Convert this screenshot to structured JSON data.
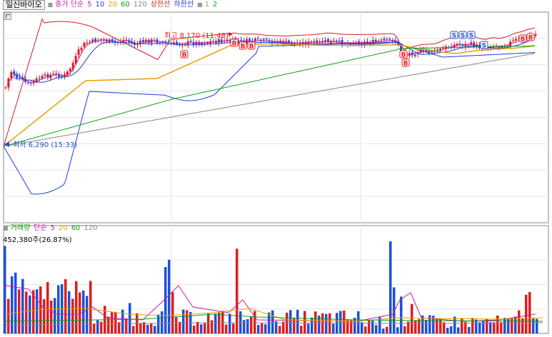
{
  "price_legend": {
    "stock_name": "일신바이오",
    "close_label": "종가 단순",
    "ma_periods": [
      "5",
      "10",
      "20",
      "60",
      "120"
    ],
    "ma_colors": [
      "#c81eaa",
      "#1e3cd2",
      "#e6a000",
      "#12a012",
      "#888888"
    ],
    "upper_limit_label": "상한선",
    "lower_limit_label": "하한선",
    "extra_values": [
      "1",
      "2"
    ],
    "colors": {
      "close": "#c81eaa",
      "upper": "#d21e1e",
      "lower": "#1e3cd2",
      "extra1": "#999999",
      "extra2": "#12a012"
    }
  },
  "volume_legend": {
    "title": "거래량",
    "ma_label": "단순",
    "ma_periods": [
      "5",
      "20",
      "60",
      "120"
    ],
    "ma_colors": [
      "#c81eaa",
      "#e6a000",
      "#12a012",
      "#888888"
    ],
    "title_color": "#12a012",
    "readout": "452,380주(26.87%)"
  },
  "annotations": {
    "high": "최고 8,170 (11:48)",
    "low": "최저 6,290 (15:33)"
  },
  "signals": {
    "buy": "B",
    "sell": "S"
  },
  "colors": {
    "up": "#e21b1b",
    "down": "#1d4fd8",
    "grid": "#e6e6e6",
    "border": "#888888"
  },
  "chart_data": {
    "type": "candlestick",
    "price_range": [
      6000,
      8500
    ],
    "high": 8170,
    "low": 6290,
    "volume_max": 1000000
  }
}
